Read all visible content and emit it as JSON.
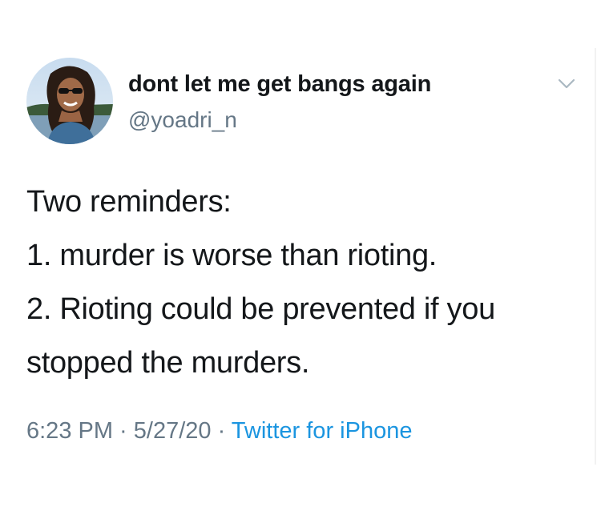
{
  "tweet": {
    "author": {
      "display_name": "dont let me get bangs again",
      "handle": "@yoadri_n"
    },
    "text_lines": [
      "Two reminders:",
      "1. murder is worse than rioting.",
      "2. Rioting could be prevented if you",
      "stopped the murders."
    ],
    "meta": {
      "time": "6:23 PM",
      "separator": " · ",
      "date": "5/27/20",
      "source": "Twitter for iPhone"
    },
    "icons": {
      "menu": "chevron-down-icon"
    },
    "colors": {
      "primary_text": "#14171a",
      "secondary_text": "#657786",
      "link": "#1b95e0"
    }
  }
}
